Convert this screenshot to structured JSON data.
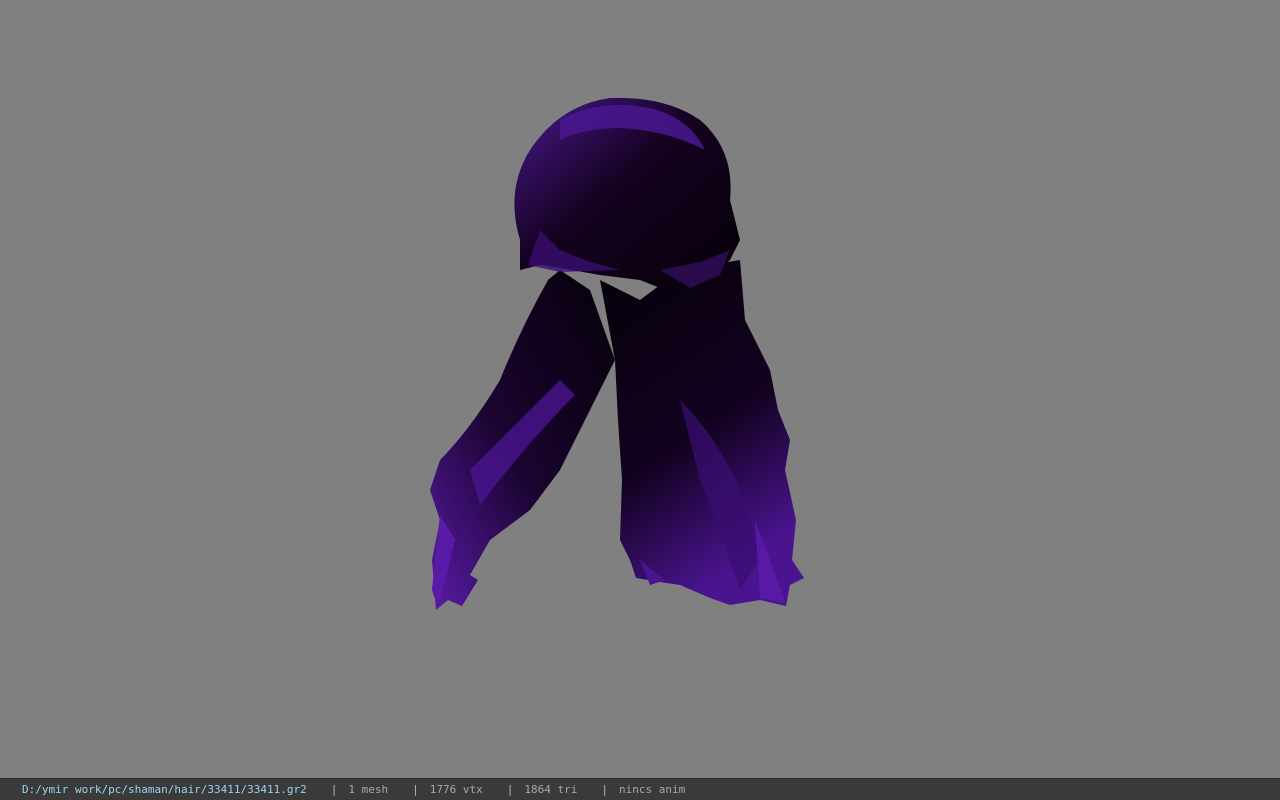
{
  "viewport": {
    "background_color": "#808080",
    "model_colors": {
      "dark": "#0a0010",
      "mid": "#2a0a4a",
      "highlight": "#5a1aa8"
    }
  },
  "status_bar": {
    "file_path": "D:/ymir work/pc/shaman/hair/33411/33411.gr2",
    "separator": "|",
    "mesh_count": "1 mesh",
    "vertex_count": "1776 vtx",
    "triangle_count": "1864 tri",
    "anim_status": "nincs anim"
  }
}
